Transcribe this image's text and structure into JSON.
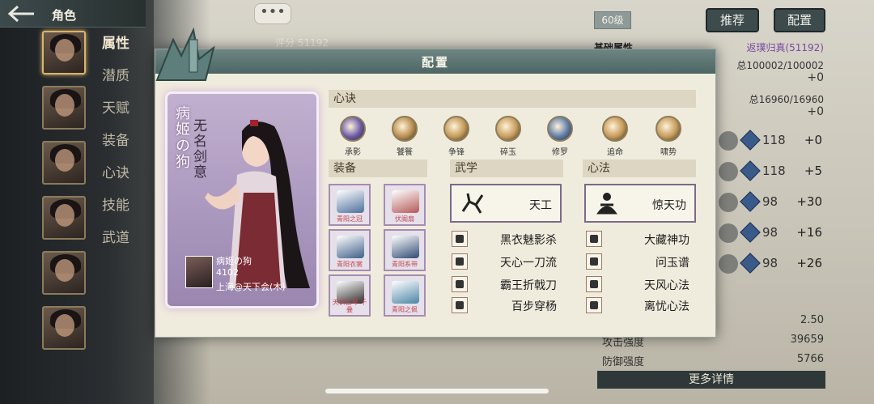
{
  "header": {
    "title": "角色"
  },
  "chat_label": "•••",
  "score_top": "评分 51192",
  "left_menu": [
    "属性",
    "潜质",
    "天赋",
    "装备",
    "心诀",
    "技能",
    "武道"
  ],
  "top_right": {
    "level": "60级",
    "recommend": "推荐",
    "config": "配置"
  },
  "stats": {
    "base_label": "基础属性",
    "reborn": "返璞归真(51192)",
    "hp_total": "总100002/100002",
    "hp_plus": "+0",
    "mp_total": "总16960/16960",
    "mp_plus": "+0",
    "crit_val": "2.50",
    "attack_label": "攻击强度",
    "attack_val": "39659",
    "defense_label": "防御强度",
    "defense_val": "5766",
    "more": "更多详情"
  },
  "side_skills": [
    {
      "num": "118",
      "plus": "+0"
    },
    {
      "num": "118",
      "plus": "+5"
    },
    {
      "num": "98",
      "plus": "+30"
    },
    {
      "num": "98",
      "plus": "+16"
    },
    {
      "num": "98",
      "plus": "+26"
    }
  ],
  "modal": {
    "title": "配置",
    "portrait": {
      "nick_vertical": "病姬の狗",
      "title_vertical": "无名剑意",
      "owner_name": "病姬の狗",
      "owner_id": "4102",
      "owner_server": "上海@天下会(木)"
    },
    "xinjue": {
      "label": "心诀",
      "items": [
        {
          "label": "承影",
          "color": "#6a58a8"
        },
        {
          "label": "饕餮",
          "color": "#b98d4e"
        },
        {
          "label": "争锋",
          "color": "#c29856"
        },
        {
          "label": "碎玉",
          "color": "#c79c5c"
        },
        {
          "label": "修罗",
          "color": "#5c7aa6"
        },
        {
          "label": "追命",
          "color": "#c69857"
        },
        {
          "label": "啸势",
          "color": "#c49a5a"
        }
      ]
    },
    "equipment": {
      "label": "装备",
      "items": [
        {
          "label": "青阳之冠",
          "color": "#4b6f9c"
        },
        {
          "label": "伏阁扇",
          "color": "#b45858"
        },
        {
          "label": "青阳衣裳",
          "color": "#3f5f88"
        },
        {
          "label": "青阳系带",
          "color": "#2f4a73"
        },
        {
          "label": "天枫古琴·千叠",
          "color": "#2d2a2a"
        },
        {
          "label": "青阳之佩",
          "color": "#4a86a6"
        }
      ]
    },
    "wuxue": {
      "label": "武学",
      "main": "天工",
      "items": [
        "黑衣魅影杀",
        "天心一刀流",
        "霸王折戟刀",
        "百步穿杨"
      ]
    },
    "xinfa": {
      "label": "心法",
      "main": "惊天功",
      "items": [
        "大藏神功",
        "问玉谱",
        "天风心法",
        "离忧心法"
      ]
    }
  }
}
